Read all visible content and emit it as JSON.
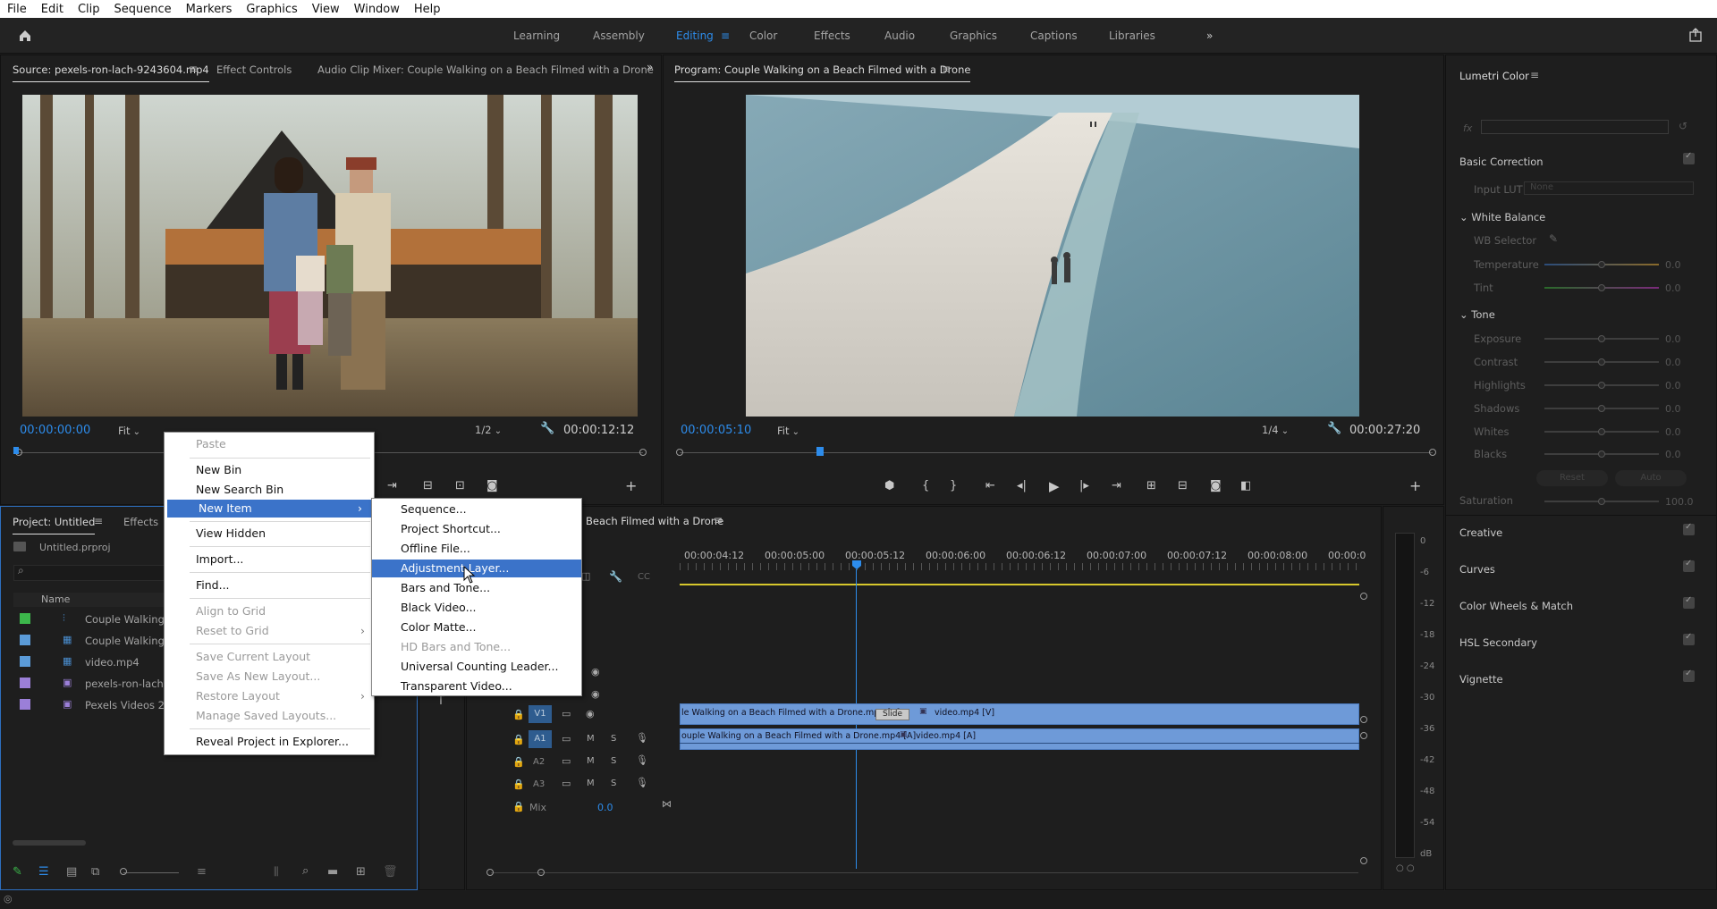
{
  "menubar": [
    "File",
    "Edit",
    "Clip",
    "Sequence",
    "Markers",
    "Graphics",
    "View",
    "Window",
    "Help"
  ],
  "workspaces": [
    "Learning",
    "Assembly",
    "Editing",
    "Color",
    "Effects",
    "Audio",
    "Graphics",
    "Captions",
    "Libraries"
  ],
  "active_workspace": "Editing",
  "source": {
    "tabs": [
      "Source: pexels-ron-lach-9243604.mp4",
      "Effect Controls",
      "Audio Clip Mixer: Couple Walking on a Beach Filmed with a Drone"
    ],
    "timecode": "00:00:00:00",
    "fit": "Fit",
    "res": "1/2",
    "duration": "00:00:12:12"
  },
  "program": {
    "title": "Program: Couple Walking on a Beach Filmed with a Drone",
    "timecode": "00:00:05:10",
    "fit": "Fit",
    "res": "1/4",
    "duration": "00:00:27:20"
  },
  "lumetri": {
    "title": "Lumetri Color",
    "fx": "fx",
    "basic": "Basic Correction",
    "input_lut": "Input LUT",
    "input_lut_val": "None",
    "white_balance": "White Balance",
    "wb_selector": "WB Selector",
    "temperature": "Temperature",
    "tint": "Tint",
    "tone": "Tone",
    "rows": [
      {
        "label": "Exposure",
        "val": "0.0"
      },
      {
        "label": "Contrast",
        "val": "0.0"
      },
      {
        "label": "Highlights",
        "val": "0.0"
      },
      {
        "label": "Shadows",
        "val": "0.0"
      },
      {
        "label": "Whites",
        "val": "0.0"
      },
      {
        "label": "Blacks",
        "val": "0.0"
      }
    ],
    "temp_val": "0.0",
    "tint_val": "0.0",
    "reset": "Reset",
    "auto": "Auto",
    "saturation": "Saturation",
    "sat_val": "100.0",
    "sections": [
      "Creative",
      "Curves",
      "Color Wheels & Match",
      "HSL Secondary",
      "Vignette"
    ]
  },
  "project": {
    "tabs": [
      "Project: Untitled",
      "Effects"
    ],
    "file": "Untitled.prproj",
    "col_name": "Name",
    "items": [
      {
        "name": "Couple Walking on",
        "color": "#3cb74b",
        "icon": "sequence-icon"
      },
      {
        "name": "Couple Walking on",
        "color": "#5b9bd8",
        "icon": "clip-icon"
      },
      {
        "name": "video.mp4",
        "color": "#5b9bd8",
        "icon": "clip-icon"
      },
      {
        "name": "pexels-ron-lach-92",
        "color": "#9b7fd8",
        "icon": "clip-icon"
      },
      {
        "name": "Pexels Videos 267",
        "color": "#9b7fd8",
        "icon": "clip-icon"
      }
    ]
  },
  "timeline": {
    "title": "Beach Filmed with a Drone",
    "ruler": [
      "00:00:04:12",
      "00:00:05:00",
      "00:00:05:12",
      "00:00:06:00",
      "00:00:06:12",
      "00:00:07:00",
      "00:00:07:12",
      "00:00:08:00",
      "00:00:0"
    ],
    "v1_clip1": "le Walking on a Beach Filmed with a Drone.mp4 [V]",
    "v1_clip2": "video.mp4 [V]",
    "slide": "Slide",
    "a1_clip1": "ouple Walking on a Beach Filmed with a Drone.mp4 [A]",
    "a1_clip2": "video.mp4 [A]",
    "tracks": [
      "V1",
      "A1",
      "A2",
      "A3"
    ],
    "mix": "Mix",
    "mix_val": "0.0"
  },
  "vu": [
    "0",
    "-6",
    "-12",
    "-18",
    "-24",
    "-30",
    "-36",
    "-42",
    "-48",
    "-54",
    "dB"
  ],
  "context_menu": {
    "items": [
      "Paste",
      "New Bin",
      "New Search Bin",
      "New Item",
      "View Hidden",
      "Import...",
      "Find...",
      "Align to Grid",
      "Reset to Grid",
      "Save Current Layout",
      "Save As New Layout...",
      "Restore Layout",
      "Manage Saved Layouts...",
      "Reveal Project in Explorer..."
    ]
  },
  "submenu": {
    "items": [
      "Sequence...",
      "Project Shortcut...",
      "Offline File...",
      "Adjustment Layer...",
      "Bars and Tone...",
      "Black Video...",
      "Color Matte...",
      "HD Bars and Tone...",
      "Universal Counting Leader...",
      "Transparent Video..."
    ]
  },
  "colors": {
    "accent": "#2d8ceb",
    "highlight": "#3b73c9",
    "clip": "#6e9ad8"
  }
}
